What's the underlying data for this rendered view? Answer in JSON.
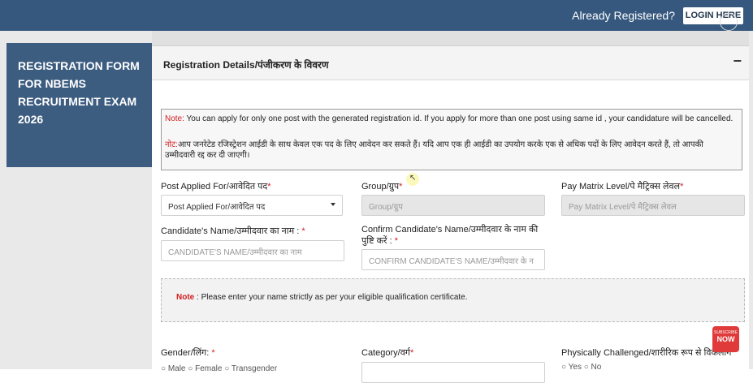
{
  "header": {
    "already_registered": "Already Registered?",
    "login_label": "LOGIN HERE"
  },
  "sidebar": {
    "title": "REGISTRATION FORM FOR NBEMS RECRUITMENT EXAM 2026"
  },
  "panel": {
    "title": "Registration Details/पंजीकरण के विवरण",
    "collapse_symbol": "−"
  },
  "note": {
    "label_en": "Note:",
    "text_en": " You can apply for only one post with the generated registration id. If you apply for more than one post using same id , your candidature will be cancelled.",
    "label_hi": "नोट:",
    "text_hi": "आप जनरेटेड रजिस्ट्रेशन आईडी के साथ केवल एक पद के लिए आवेदन कर सकते हैं। यदि आप एक ही आईडी का उपयोग करके एक से अधिक पदों के लिए आवेदन करते हैं, तो आपकी उम्मीदवारी रद्द कर दी जाएगी।"
  },
  "fields": {
    "post": {
      "label": "Post Applied For/आवेदित पद",
      "required": "*",
      "value": "Post Applied For/आवेदित पद"
    },
    "group": {
      "label": "Group/ग्रुप",
      "required": "*",
      "placeholder": "Group/ग्रुप"
    },
    "pay": {
      "label": "Pay Matrix Level/पे मैट्रिक्स लेवल",
      "required": "*",
      "placeholder": "Pay Matrix Level/पे मैट्रिक्स लेवल"
    },
    "name": {
      "label": "Candidate's Name/उम्मीदवार का नाम : ",
      "required": "*",
      "placeholder": "CANDIDATE'S NAME/उम्मीदवार का नाम"
    },
    "confirm_name": {
      "label": "Confirm Candidate's Name/उम्मीदवार के नाम की पुष्टि करें : ",
      "required": "*",
      "placeholder": "CONFIRM CANDIDATE'S NAME/उम्मीदवार के न"
    },
    "gender": {
      "label": "Gender/लिंग: ",
      "required": "*",
      "options": "○ Male ○ Female ○ Transgender"
    },
    "category": {
      "label": "Category/वर्ग",
      "required": "*"
    },
    "physically": {
      "label": "Physically Challenged/शारीरिक रूप से विकलांग",
      "required": "*",
      "options": "○ Yes ○ No"
    }
  },
  "name_note": {
    "label": "Note",
    "text": " : Please enter your name strictly as per your eligible qualification certificate."
  },
  "badge": {
    "line1": "SUBSCRIBE",
    "line2": "NOW"
  },
  "colors": {
    "header": "#36587e",
    "sidebar_box": "#3c5c80",
    "required": "#d21e1e",
    "badge": "#e03a3a"
  }
}
